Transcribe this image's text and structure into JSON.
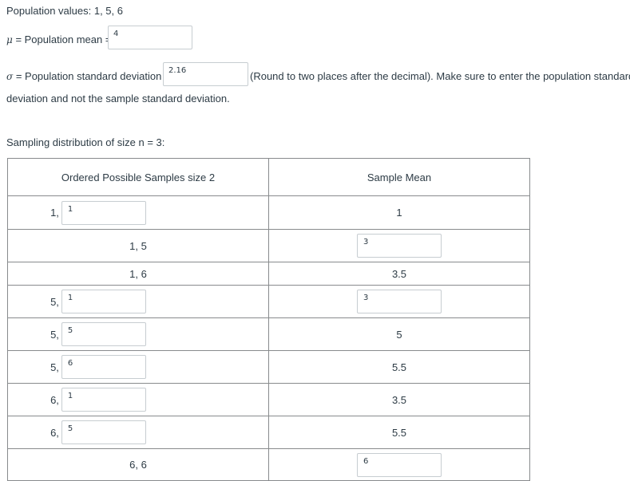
{
  "population_line": "Population values: 1, 5, 6",
  "mean": {
    "symbol": "μ",
    "label": "= Population mean =",
    "value": "4"
  },
  "sd": {
    "symbol": "σ",
    "label": "= Population standard deviation =",
    "value": "2.16",
    "note_line1": "(Round to two places after the decimal). Make sure to enter the population standard",
    "note_line2": "deviation and not the sample standard deviation."
  },
  "sampling_heading": "Sampling distribution of size n = 3:",
  "table": {
    "headers": [
      "Ordered Possible Samples size 2",
      "Sample Mean"
    ],
    "rows": [
      {
        "prefix": "1,",
        "sample_input": "1",
        "sample_text": null,
        "mean_text": "1",
        "mean_input": null
      },
      {
        "prefix": null,
        "sample_input": null,
        "sample_text": "1, 5",
        "mean_text": null,
        "mean_input": "3"
      },
      {
        "prefix": null,
        "sample_input": null,
        "sample_text": "1, 6",
        "mean_text": "3.5",
        "mean_input": null
      },
      {
        "prefix": "5,",
        "sample_input": "1",
        "sample_text": null,
        "mean_text": null,
        "mean_input": "3"
      },
      {
        "prefix": "5,",
        "sample_input": "5",
        "sample_text": null,
        "mean_text": "5",
        "mean_input": null
      },
      {
        "prefix": "5,",
        "sample_input": "6",
        "sample_text": null,
        "mean_text": "5.5",
        "mean_input": null
      },
      {
        "prefix": "6,",
        "sample_input": "1",
        "sample_text": null,
        "mean_text": "3.5",
        "mean_input": null
      },
      {
        "prefix": "6,",
        "sample_input": "5",
        "sample_text": null,
        "mean_text": "5.5",
        "mean_input": null
      },
      {
        "prefix": null,
        "sample_input": null,
        "sample_text": "6, 6",
        "mean_text": null,
        "mean_input": "6"
      }
    ]
  }
}
